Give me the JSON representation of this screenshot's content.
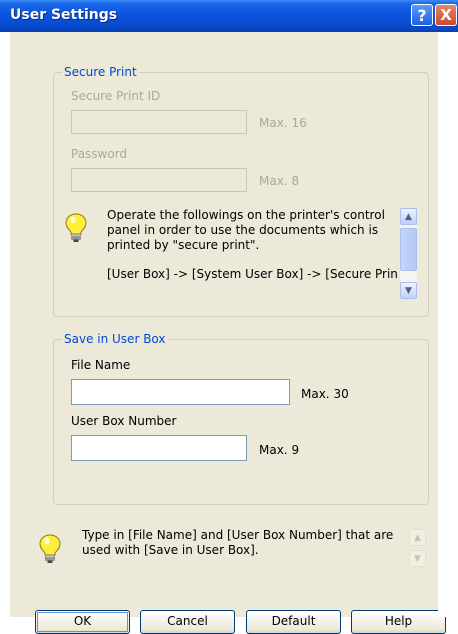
{
  "dialog": {
    "title": "User Settings",
    "help_glyph": "?",
    "close_glyph": "X"
  },
  "secure_print": {
    "legend": "Secure Print",
    "id_label": "Secure Print ID",
    "id_value": "",
    "id_max": "Max. 16",
    "password_label": "Password",
    "password_value": "",
    "password_max": "Max. 8",
    "info_text": "Operate the followings on the printer's control panel in order to use the documents which is printed by \"secure print\".",
    "info_path": "[User Box] -> [System User Box] -> [Secure Print"
  },
  "save_in_user_box": {
    "legend": "Save in User Box",
    "file_name_label": "File Name",
    "file_name_value": "",
    "file_name_max": "Max. 30",
    "box_number_label": "User Box Number",
    "box_number_value": "",
    "box_number_max": "Max. 9"
  },
  "hint": {
    "text": "Type in [File Name] and [User Box Number] that are used with [Save in User Box]."
  },
  "buttons": {
    "ok": "OK",
    "cancel": "Cancel",
    "default": "Default",
    "help": "Help"
  },
  "icons": {
    "help": "help-icon",
    "close": "close-icon",
    "bulb": "lightbulb-icon",
    "up": "scroll-up-icon",
    "down": "scroll-down-icon"
  }
}
